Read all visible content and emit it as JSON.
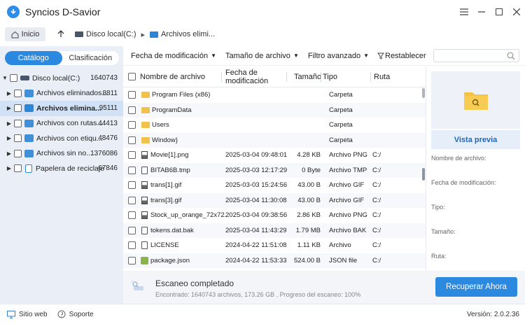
{
  "app": {
    "title": "Syncios D-Savior",
    "version": "Versión: 2.0.2.36"
  },
  "nav": {
    "home_label": "Inicio",
    "breadcrumb": [
      "Disco local(C:)",
      "Archivos elimi..."
    ]
  },
  "left": {
    "tabs": [
      "Catálogo",
      "Clasificación"
    ],
    "tree": [
      {
        "label": "Disco local(C:)",
        "count": "1640743",
        "icon": "drive-icon"
      },
      {
        "label": "Archivos eliminados...",
        "count": "8811",
        "icon": "user-folder-icon"
      },
      {
        "label": "Archivos elimina...",
        "count": "95111",
        "icon": "deleted-folder-icon"
      },
      {
        "label": "Archivos con rutas...",
        "count": "44413",
        "icon": "path-folder-icon"
      },
      {
        "label": "Archivos con etiqu...",
        "count": "48476",
        "icon": "tag-folder-icon"
      },
      {
        "label": "Archivos sin no...",
        "count": "1376086",
        "icon": "unnamed-folder-icon"
      },
      {
        "label": "Papelera de reciclaje",
        "count": "67846",
        "icon": "recycle-bin-icon"
      }
    ]
  },
  "toolbar": {
    "filters": [
      "Fecha de modificación",
      "Tamaño de archivo",
      "Filtro avanzado"
    ],
    "reset_label": "Restablecer",
    "search_placeholder": ""
  },
  "table": {
    "headers": {
      "name": "Nombre de archivo",
      "date": "Fecha de modificación",
      "size": "Tamaño",
      "type": "Tipo",
      "path": "Ruta"
    },
    "rows": [
      {
        "icon": "folder",
        "name": "Program Files (x86)",
        "date": "",
        "size": "",
        "type": "Carpeta",
        "path": ""
      },
      {
        "icon": "folder",
        "name": "ProgramData",
        "date": "",
        "size": "",
        "type": "Carpeta",
        "path": ""
      },
      {
        "icon": "folder",
        "name": "Users",
        "date": "",
        "size": "",
        "type": "Carpeta",
        "path": ""
      },
      {
        "icon": "folder",
        "name": "Window}",
        "date": "",
        "size": "",
        "type": "Carpeta",
        "path": ""
      },
      {
        "icon": "file",
        "name": "Movie[1].png",
        "date": "2025-03-04 09:48:01",
        "size": "4.28 KB",
        "type": "Archivo PNG",
        "path": "C:/"
      },
      {
        "icon": "file",
        "name": "BITAB6B.tmp",
        "date": "2025-03-03 12:17:29",
        "size": "0 Byte",
        "type": "Archivo TMP",
        "path": "C:/"
      },
      {
        "icon": "file",
        "name": "trans[1].gif",
        "date": "2025-03-03 15:24:56",
        "size": "43.00 B",
        "type": "Archivo GIF",
        "path": "C:/"
      },
      {
        "icon": "file",
        "name": "trans[3].gif",
        "date": "2025-03-04 11:30:08",
        "size": "43.00 B",
        "type": "Archivo GIF",
        "path": "C:/"
      },
      {
        "icon": "file",
        "name": "Stock_up_orange_72x72...",
        "date": "2025-03-04 09:38:56",
        "size": "2.86 KB",
        "type": "Archivo PNG",
        "path": "C:/"
      },
      {
        "icon": "file",
        "name": "tokens.dat.bak",
        "date": "2025-03-04 11:43:29",
        "size": "1.79 MB",
        "type": "Archivo BAK",
        "path": "C:/"
      },
      {
        "icon": "file",
        "name": "LICENSE",
        "date": "2024-04-22 11:51:08",
        "size": "1.11 KB",
        "type": "Archivo",
        "path": "C:/"
      },
      {
        "icon": "json",
        "name": "package.json",
        "date": "2024-04-22 11:53:33",
        "size": "524.00 B",
        "type": "JSON file",
        "path": "C:/"
      }
    ]
  },
  "preview": {
    "button_label": "Vista previa",
    "labels": [
      "Nombre de archivo:",
      "Fecha de modificación:",
      "Tipo:",
      "Tamaño:",
      "Ruta:"
    ]
  },
  "scan": {
    "title": "Escaneo completado",
    "subtitle": "Encontrado: 1640743 archivos, 173.26 GB , Progreso del escaneo: 100%",
    "recover_label": "Recuperar Ahora"
  },
  "status": {
    "website_label": "Sitio web",
    "support_label": "Soporte"
  }
}
